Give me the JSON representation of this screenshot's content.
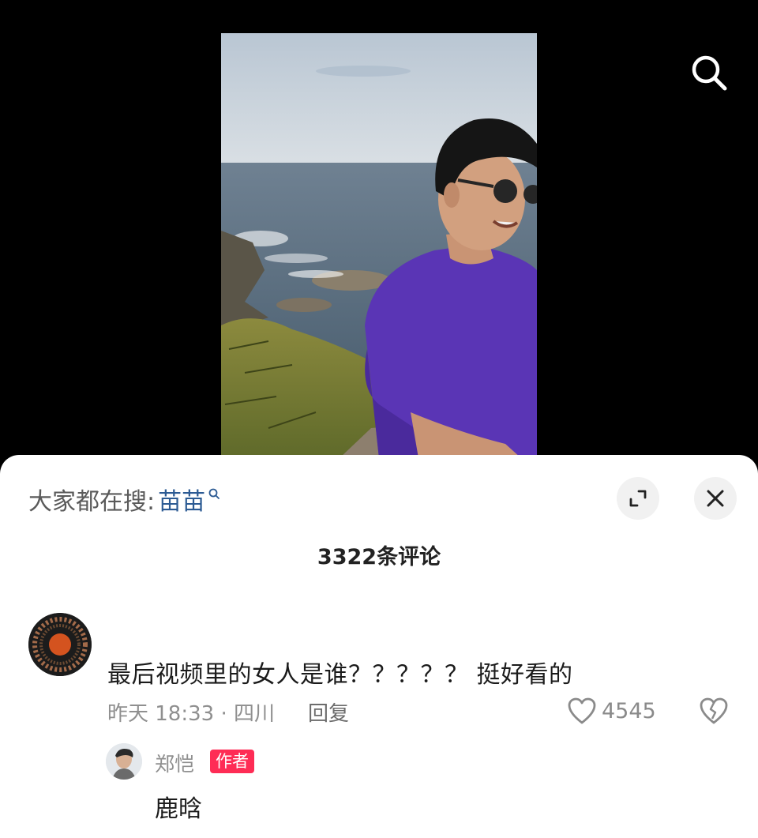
{
  "video": {
    "search_icon": "search-icon"
  },
  "sheet": {
    "trending_prefix": "大家都在搜:",
    "trending_keyword": "苗苗",
    "trending_icon": "search-icon",
    "expand_icon": "expand-icon",
    "close_icon": "close-icon",
    "comment_count_label": "3322条评论"
  },
  "comments": [
    {
      "username": "",
      "text": "最后视频里的女人是谁？？？？？ 挺好看的",
      "meta": "昨天 18:33 · 四川",
      "reply_label": "回复",
      "like_icon": "heart-icon",
      "likes": "4545",
      "dislike_icon": "broken-heart-icon"
    }
  ],
  "replies": [
    {
      "username": "郑恺",
      "badge": "作者",
      "text": "鹿晗"
    }
  ],
  "colors": {
    "keyword": "#2b5a93",
    "author_badge": "#fe2c55",
    "sheet_bg": "#ffffff",
    "shirt": "#5a35b5"
  }
}
